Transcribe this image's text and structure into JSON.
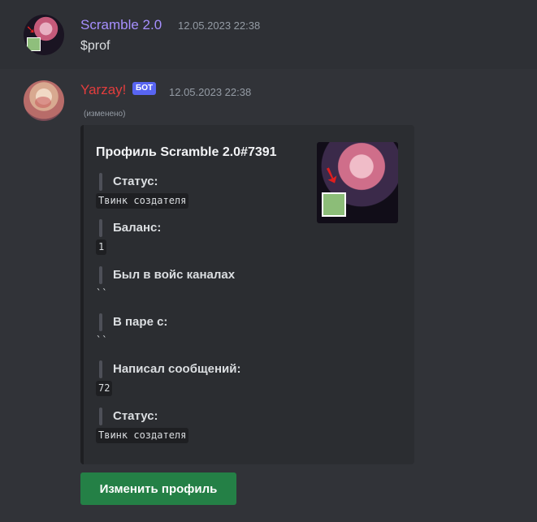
{
  "messages": [
    {
      "author": "Scramble 2.0",
      "timestamp": "12.05.2023 22:38",
      "content": "$prof"
    },
    {
      "author": "Yarzay!",
      "badge": "БОТ",
      "timestamp": "12.05.2023 22:38",
      "edited": "(изменено)",
      "embed": {
        "title": "Профиль Scramble 2.0#7391",
        "fields": [
          {
            "name": "Статус:",
            "value": "Твинк создателя"
          },
          {
            "name": "Баланс:",
            "value": "1"
          },
          {
            "name": "Был в войс каналах",
            "value": "``"
          },
          {
            "name": "В паре с:",
            "value": "``"
          },
          {
            "name": "Написал сообщений:",
            "value": "72"
          },
          {
            "name": "Статус:",
            "value": "Твинк создателя"
          }
        ]
      },
      "button_label": "Изменить профиль"
    }
  ],
  "colors": {
    "background": "#313338",
    "author_1": "#a68ffe",
    "author_2": "#e23d3d",
    "bot_badge": "#5865f2",
    "embed_bg": "#2b2d31",
    "button_green": "#248046"
  },
  "icons": [
    "user-avatar-icon",
    "bot-avatar-icon",
    "profile-thumbnail-image"
  ]
}
